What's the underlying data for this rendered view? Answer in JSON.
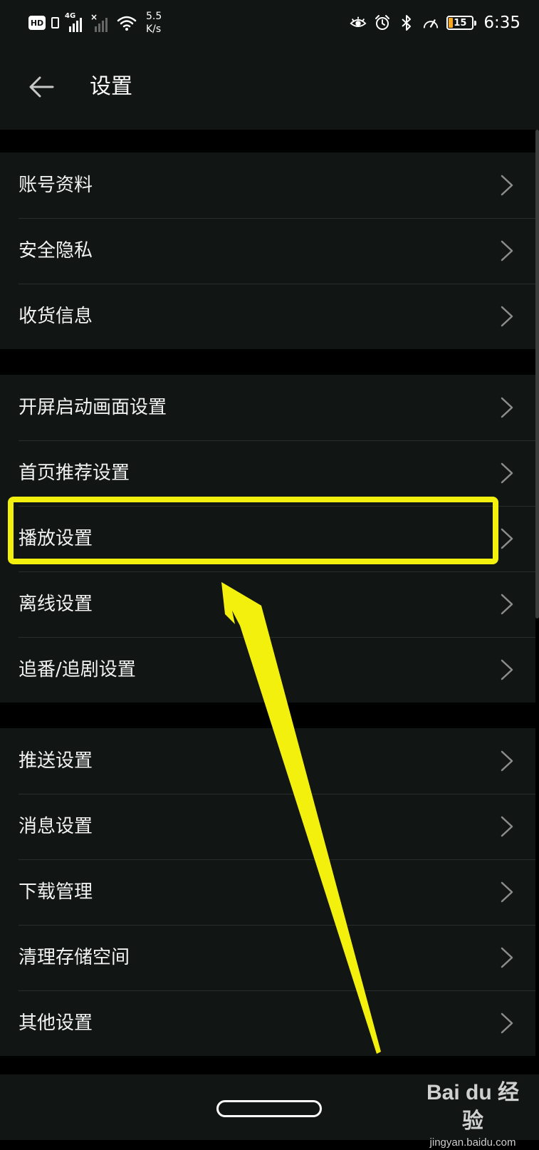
{
  "status_bar": {
    "hd_label": "HD",
    "network_label": "4G",
    "speed_value": "5.5",
    "speed_unit": "K/s",
    "battery_level": "15",
    "time": "6:35",
    "icons": [
      "eye-comfort-icon",
      "alarm-icon",
      "bluetooth-icon",
      "speedometer-icon"
    ]
  },
  "header": {
    "title": "设置",
    "back_icon": "arrow-left-icon"
  },
  "groups": [
    {
      "items": [
        {
          "label": "账号资料"
        },
        {
          "label": "安全隐私"
        },
        {
          "label": "收货信息"
        }
      ]
    },
    {
      "items": [
        {
          "label": "开屏启动画面设置"
        },
        {
          "label": "首页推荐设置"
        },
        {
          "label": "播放设置"
        },
        {
          "label": "离线设置"
        },
        {
          "label": "追番/追剧设置"
        }
      ]
    },
    {
      "items": [
        {
          "label": "推送设置"
        },
        {
          "label": "消息设置"
        },
        {
          "label": "下载管理"
        },
        {
          "label": "清理存储空间"
        },
        {
          "label": "其他设置"
        }
      ]
    }
  ],
  "annotation": {
    "highlighted_item": "播放设置",
    "color": "#f4f00e"
  },
  "watermark": {
    "brand": "Bai du 经验",
    "url": "jingyan.baidu.com"
  },
  "colors": {
    "background": "#000000",
    "surface": "#111513",
    "divider": "#2a2e2c",
    "text": "#f2f2f2",
    "chevron": "#8a8d8b"
  }
}
